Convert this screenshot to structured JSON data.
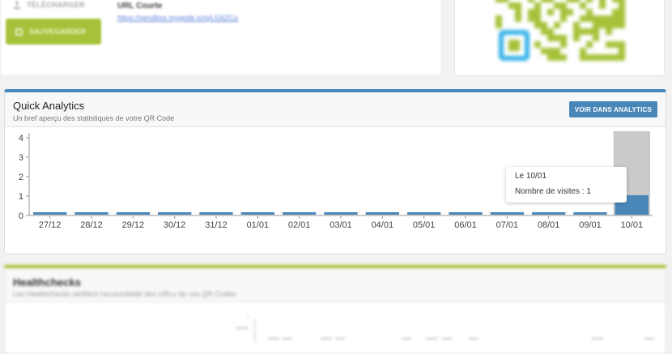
{
  "top": {
    "download_label": "TÉLÉCHARGER",
    "save_label": "SAUVEGARDER",
    "short_url_label": "URL Courte",
    "short_url_value": "https://sendbox.myqode.io/q/LG6ZCu"
  },
  "colors": {
    "primary_blue": "#4a87b9",
    "brand_green": "#a6c23a",
    "qr_eye_blue": "#36b3e8",
    "highlight_gray": "#cacaca"
  },
  "quick_analytics": {
    "title": "Quick Analytics",
    "subtitle": "Un bref aperçu des statistiques de votre QR Code",
    "button_label": "VOIR DANS ANALYTICS",
    "tooltip": {
      "date": "Le 10/01",
      "visits": "Nombre de visites : 1"
    }
  },
  "chart_data": {
    "type": "bar",
    "categories": [
      "27/12",
      "28/12",
      "29/12",
      "30/12",
      "31/12",
      "01/01",
      "02/01",
      "03/01",
      "04/01",
      "05/01",
      "06/01",
      "07/01",
      "08/01",
      "09/01",
      "10/01"
    ],
    "values": [
      0,
      0,
      0,
      0,
      0,
      0,
      0,
      0,
      0,
      0,
      0,
      0,
      0,
      0,
      1
    ],
    "ylim": [
      0,
      4
    ],
    "yticks": [
      "0",
      "1",
      "2",
      "3",
      "4"
    ],
    "highlighted_category": "10/01",
    "grid": false
  },
  "healthchecks": {
    "title": "Healthchecks",
    "subtitle": "Les Healthchecks vérifient l'accessibilité des URLs de vos QR Codes"
  }
}
